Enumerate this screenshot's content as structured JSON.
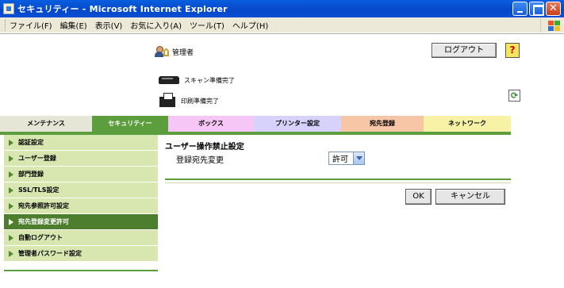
{
  "window": {
    "title": "セキュリティー - Microsoft Internet Explorer"
  },
  "menu": [
    "ファイル(F)",
    "編集(E)",
    "表示(V)",
    "お気に入り(A)",
    "ツール(T)",
    "ヘルプ(H)"
  ],
  "header": {
    "user_label": "管理者",
    "logout_label": "ログアウト",
    "help_label": "?",
    "scan_status": "スキャン準備完了",
    "print_status": "印刷準備完了"
  },
  "tabs": [
    {
      "label": "メンテナンス",
      "color": "#e6e6d6"
    },
    {
      "label": "セキュリティー",
      "color": "#5c9e3e",
      "active": true
    },
    {
      "label": "ボックス",
      "color": "#f6c6f6"
    },
    {
      "label": "プリンター設定",
      "color": "#d6d2fb"
    },
    {
      "label": "宛先登録",
      "color": "#f7c6a6"
    },
    {
      "label": "ネットワーク",
      "color": "#f7f2a6"
    }
  ],
  "sidebar": {
    "items": [
      {
        "label": "認証設定"
      },
      {
        "label": "ユーザー登録"
      },
      {
        "label": "部門登録"
      },
      {
        "label": "SSL/TLS設定"
      },
      {
        "label": "宛先参照許可設定"
      },
      {
        "label": "宛先登録変更許可",
        "active": true
      },
      {
        "label": "自動ログアウト"
      },
      {
        "label": "管理者パスワード設定"
      }
    ]
  },
  "main": {
    "title": "ユーザー操作禁止設定",
    "field_label": "登録宛先変更",
    "field_value": "許可",
    "ok_label": "OK",
    "cancel_label": "キャンセル"
  },
  "colors": {
    "accent_green": "#5c9e3e",
    "active_side": "#4d7e2e",
    "side_bg": "#d8e6b0"
  }
}
